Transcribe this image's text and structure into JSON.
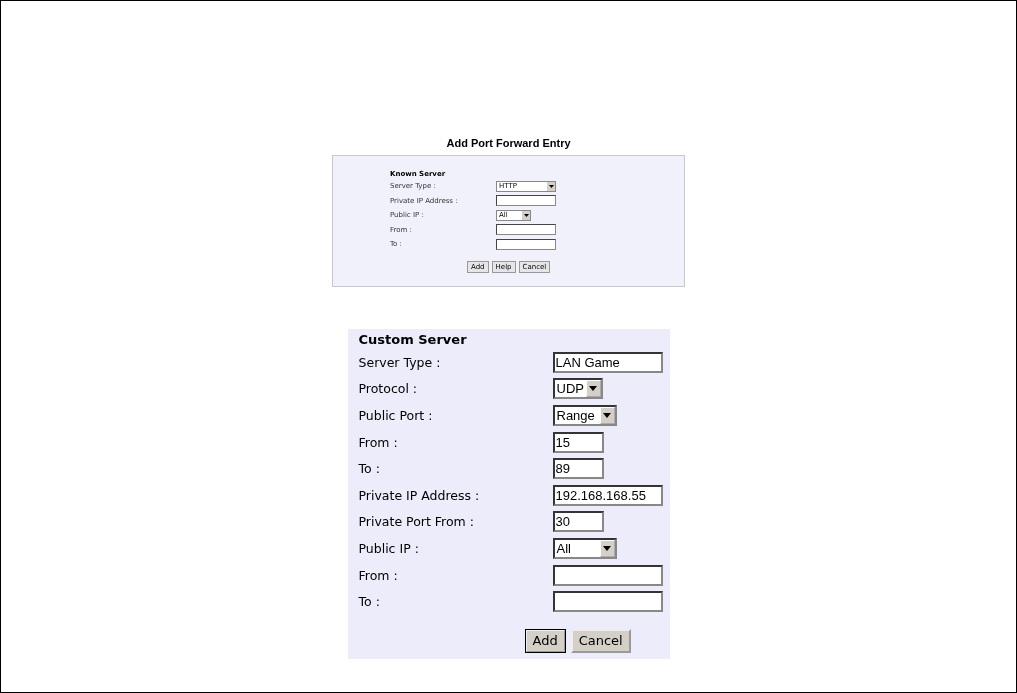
{
  "known_server_form": {
    "title": "Add Port Forward Entry",
    "heading": "Known Server",
    "fields": [
      {
        "label": "Server Type :",
        "kind": "select",
        "value": "HTTP"
      },
      {
        "label": "Private IP Address :",
        "kind": "text"
      },
      {
        "label": "Public IP :",
        "kind": "select",
        "value": "All"
      },
      {
        "label": "From :",
        "kind": "text"
      },
      {
        "label": "To :",
        "kind": "text"
      }
    ],
    "buttons": [
      {
        "label": "Add",
        "focused": false
      },
      {
        "label": "Help",
        "focused": false
      },
      {
        "label": "Cancel",
        "focused": false
      }
    ]
  },
  "custom_server_form": {
    "heading": "Custom Server",
    "fields": [
      {
        "label": "Server Type :",
        "kind": "text",
        "value": "LAN Game"
      },
      {
        "label": "Protocol :",
        "kind": "select",
        "value": "UDP"
      },
      {
        "label": "Public Port :",
        "kind": "select",
        "value": "Range"
      },
      {
        "label": "From :",
        "kind": "text",
        "value": "15"
      },
      {
        "label": "To :",
        "kind": "text",
        "value": "89"
      },
      {
        "label": "Private IP Address :",
        "kind": "text",
        "value": "192.168.168.55"
      },
      {
        "label": "Private Port From :",
        "kind": "text",
        "value": "30"
      },
      {
        "label": "Public IP :",
        "kind": "select",
        "value": "All"
      },
      {
        "label": "From :",
        "kind": "text"
      },
      {
        "label": "To :",
        "kind": "text"
      }
    ],
    "buttons": [
      {
        "label": "Add",
        "focused": true
      },
      {
        "label": "Cancel",
        "focused": false
      }
    ]
  }
}
